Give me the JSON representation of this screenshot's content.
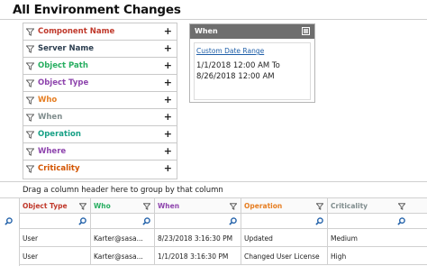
{
  "page": {
    "title": "All Environment Changes"
  },
  "filters": {
    "items": [
      {
        "label": "Component Name",
        "color": "#c0392b"
      },
      {
        "label": "Server Name",
        "color": "#2c3e50"
      },
      {
        "label": "Object Path",
        "color": "#27ae60"
      },
      {
        "label": "Object Type",
        "color": "#8e44ad"
      },
      {
        "label": "Who",
        "color": "#e67e22"
      },
      {
        "label": "When",
        "color": "#7f8c8d"
      },
      {
        "label": "Operation",
        "color": "#16a085"
      },
      {
        "label": "Where",
        "color": "#8e44ad"
      },
      {
        "label": "Criticality",
        "color": "#d35400"
      }
    ],
    "add_glyph": "+"
  },
  "when_panel": {
    "title": "When",
    "link": "Custom Date Range",
    "range_line1": "1/1/2018 12:00 AM To",
    "range_line2": "8/26/2018 12:00 AM"
  },
  "grid": {
    "group_hint": "Drag a column header here to group by that column",
    "columns": [
      {
        "label": "Object Type",
        "color": "#c0392b"
      },
      {
        "label": "Who",
        "color": "#27ae60"
      },
      {
        "label": "When",
        "color": "#8e44ad"
      },
      {
        "label": "Operation",
        "color": "#e67e22"
      },
      {
        "label": "Criticality",
        "color": "#7f8c8d"
      }
    ],
    "rows": [
      [
        "User",
        "Karter@sasa...",
        "8/23/2018 3:16:30 PM",
        "Updated",
        "Medium"
      ],
      [
        "User",
        "Karter@sasa...",
        "1/1/2018 3:16:30 PM",
        "Changed User License",
        "High"
      ]
    ]
  },
  "icons": {
    "filter": "funnel-icon",
    "add": "plus-icon",
    "search": "magnifier-icon",
    "panel_menu": "window-menu-icon"
  }
}
